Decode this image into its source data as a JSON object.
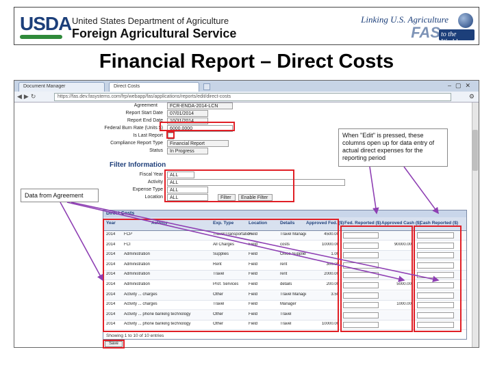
{
  "banner": {
    "usda_logo": "USDA",
    "agency_top": "United States Department of Agriculture",
    "agency_main": "Foreign Agricultural Service",
    "fas_tagline": "Linking U.S. Agriculture",
    "fas_logo": "FAS",
    "fas_world": "to the World"
  },
  "slide_title": "Financial Report – Direct Costs",
  "browser": {
    "tabs": [
      {
        "label": "Document Manager"
      },
      {
        "label": "Direct Costs"
      }
    ],
    "url": "https://fas.dev.fasystems.com/frp/webapp/fas/applications/reports/edit/direct-costs"
  },
  "form": {
    "fields": [
      {
        "label": "Agreement",
        "value": "FCR-ENDA-2014-LCN"
      },
      {
        "label": "Report Start Date",
        "value": "07/01/2014"
      },
      {
        "label": "Report End Date",
        "value": "10/31/2014"
      },
      {
        "label": "Federal Burn Rate (Units $)",
        "value": "6000.0000"
      },
      {
        "label": "Is Last Report",
        "value": ""
      },
      {
        "label": "Compliance Report Type",
        "value": "Financial Report"
      },
      {
        "label": "Status",
        "value": "In Progress"
      }
    ],
    "filter_title": "Filter Information",
    "filters": [
      {
        "label": "Fiscal Year",
        "value": "ALL"
      },
      {
        "label": "Activity",
        "value": "ALL"
      },
      {
        "label": "Expense Type",
        "value": "ALL"
      },
      {
        "label": "Location",
        "value": "ALL"
      }
    ],
    "filter_button": "Filter",
    "enable_button": "Enable Filter"
  },
  "callouts": {
    "edit_note": "When \"Edit\" is pressed, these columns open up for data entry of actual direct expenses for the reporting period",
    "agreement_note": "Data from Agreement"
  },
  "table": {
    "title": "Direct Costs",
    "headers": [
      "Year",
      "Activity",
      "Exp. Type",
      "Location",
      "Details",
      "Approved Fed. ($)",
      "Fed. Reported ($)",
      "Approved Cash ($)",
      "Cash Reported ($)"
    ],
    "rows": [
      [
        "2014",
        "FCP",
        "Travel/Transportation",
        "Field",
        "Travel Manager",
        "4500.00",
        "",
        "",
        ""
      ],
      [
        "2014",
        "FCI",
        "All Charges",
        "Field",
        "costs",
        "10000.00",
        "",
        "90000.00",
        ""
      ],
      [
        "2014",
        "Administration",
        "Supplies",
        "Field",
        "Office Supplies",
        "1.00",
        "",
        "",
        ""
      ],
      [
        "2014",
        "Administration",
        "Rent",
        "Field",
        "rent",
        "300.00",
        "",
        "",
        ""
      ],
      [
        "2014",
        "Administration",
        "Travel",
        "Field",
        "rent",
        "2000.00",
        "",
        "",
        ""
      ],
      [
        "2014",
        "Administration",
        "Prof. Services",
        "Field",
        "details",
        "200.00",
        "",
        "5000.00",
        ""
      ],
      [
        "2014",
        "Activity ... charges",
        "Other",
        "Field",
        "Travel Manager type",
        "3.50",
        "",
        "",
        ""
      ],
      [
        "2014",
        "Activity ... charges",
        "Travel",
        "Field",
        "Manager",
        "",
        "",
        "1000.00",
        ""
      ],
      [
        "2014",
        "Activity ... phone banking technology",
        "Other",
        "Field",
        "Travel",
        "",
        "",
        "",
        ""
      ],
      [
        "2014",
        "Activity ... phone banking technology",
        "Other",
        "Field",
        "Travel",
        "10000.00",
        "",
        "",
        ""
      ]
    ],
    "footer": "Showing 1 to 10 of 10 entries",
    "save_button": "Save"
  },
  "colors": {
    "highlight": "#e01e25",
    "arrow": "#8e3fb3",
    "header_blue": "#1f3f7a"
  }
}
